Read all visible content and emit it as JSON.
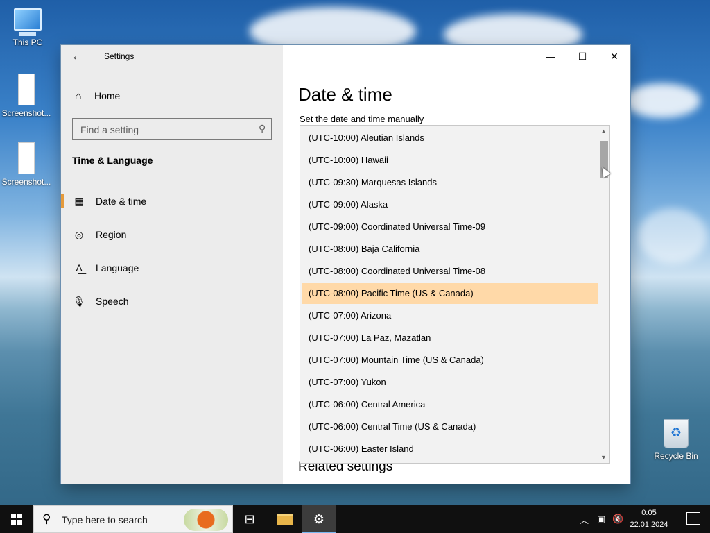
{
  "desktop": {
    "icons": [
      {
        "label": "This PC"
      },
      {
        "label": "Screenshot..."
      },
      {
        "label": "Screenshot..."
      },
      {
        "label": "Recycle Bin"
      }
    ]
  },
  "window": {
    "app_title": "Settings",
    "back_icon": "arrow-left-icon",
    "controls": {
      "minimize": "—",
      "maximize": "☐",
      "close": "✕"
    }
  },
  "sidebar": {
    "home_label": "Home",
    "search_placeholder": "Find a setting",
    "section_title": "Time & Language",
    "items": [
      {
        "label": "Date & time",
        "icon": "calendar-clock-icon",
        "active": true
      },
      {
        "label": "Region",
        "icon": "globe-icon",
        "active": false
      },
      {
        "label": "Language",
        "icon": "language-icon",
        "active": false
      },
      {
        "label": "Speech",
        "icon": "microphone-icon",
        "active": false
      }
    ]
  },
  "main": {
    "title": "Date & time",
    "sub_label": "Set the date and time manually",
    "related_title": "Related settings"
  },
  "timezone_list": {
    "selected_index": 7,
    "items": [
      "(UTC-10:00) Aleutian Islands",
      "(UTC-10:00) Hawaii",
      "(UTC-09:30) Marquesas Islands",
      "(UTC-09:00) Alaska",
      "(UTC-09:00) Coordinated Universal Time-09",
      "(UTC-08:00) Baja California",
      "(UTC-08:00) Coordinated Universal Time-08",
      "(UTC-08:00) Pacific Time (US & Canada)",
      "(UTC-07:00) Arizona",
      "(UTC-07:00) La Paz, Mazatlan",
      "(UTC-07:00) Mountain Time (US & Canada)",
      "(UTC-07:00) Yukon",
      "(UTC-06:00) Central America",
      "(UTC-06:00) Central Time (US & Canada)",
      "(UTC-06:00) Easter Island"
    ],
    "highlight_color": "#ffd9a8"
  },
  "taskbar": {
    "search_placeholder": "Type here to search",
    "clock_time": "0:05",
    "clock_date": "22.01.2024"
  },
  "colors": {
    "accent": "#e59a3b",
    "sidebar_bg": "#ececec"
  }
}
